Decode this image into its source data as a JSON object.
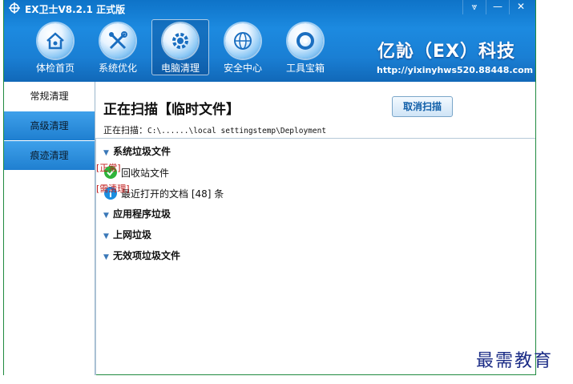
{
  "window": {
    "title": "EX卫士V8.2.1 正式版",
    "controls": {
      "menu": "⩔",
      "minimize": "—",
      "close": "✕"
    }
  },
  "nav": [
    {
      "label": "体检首页",
      "icon": "home-icon"
    },
    {
      "label": "系统优化",
      "icon": "tools-icon"
    },
    {
      "label": "电脑清理",
      "icon": "gear-icon",
      "active": true
    },
    {
      "label": "安全中心",
      "icon": "globe-icon"
    },
    {
      "label": "工具宝箱",
      "icon": "ring-icon"
    }
  ],
  "brand": {
    "name": "亿訫（EX）科技",
    "url": "http://yixinyhws520.88448.com"
  },
  "sidebar": [
    {
      "label": "常规清理",
      "active": true
    },
    {
      "label": "高级清理"
    },
    {
      "label": "痕迹清理"
    }
  ],
  "main": {
    "title": "正在扫描【临时文件】",
    "cancel_label": "取消扫描",
    "path_prefix": "正在扫描：",
    "path_value": "C:\\......\\local settingstemp\\Deployment"
  },
  "tree": {
    "cat1": "系统垃圾文件",
    "item1": {
      "label": "回收站文件",
      "status": "[正常]"
    },
    "item2": {
      "label": "最近打开的文档 [48] 条",
      "status": "[需清理]"
    },
    "cat2": "应用程序垃圾",
    "cat3": "上网垃圾",
    "cat4": "无效项垃圾文件"
  },
  "watermark": "最需教育",
  "colors": {
    "accent": "#1a7fd4",
    "status_red": "#c01818",
    "ok_green": "#2fb43a",
    "info_blue": "#1b8ee0"
  }
}
